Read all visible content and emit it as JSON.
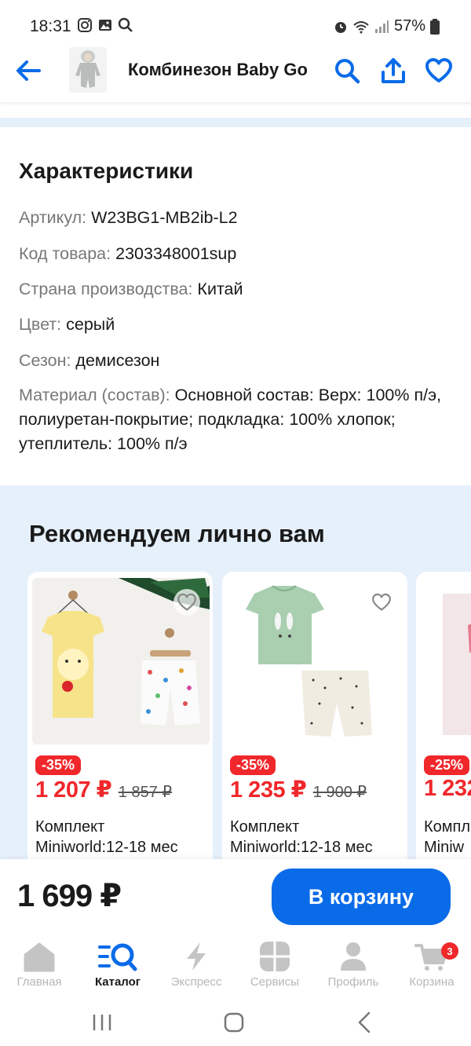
{
  "status_bar": {
    "time": "18:31",
    "battery": "57%",
    "left_icons": [
      "instagram-icon",
      "gallery-icon",
      "search-icon"
    ],
    "right_icons": [
      "alarm-icon",
      "wifi-icon",
      "signal-icon",
      "battery-icon"
    ]
  },
  "header": {
    "title": "Комбинезон Baby Go",
    "icons": [
      "back-arrow-icon",
      "search-icon",
      "share-icon",
      "heart-icon"
    ],
    "accent": "#0a6be8"
  },
  "characteristics": {
    "title": "Характеристики",
    "rows": [
      {
        "key": "Артикул:",
        "value": "W23BG1-MB2ib-L2"
      },
      {
        "key": "Код товара:",
        "value": "2303348001sup"
      },
      {
        "key": "Страна производства:",
        "value": "Китай"
      },
      {
        "key": "Цвет:",
        "value": "серый"
      },
      {
        "key": "Сезон:",
        "value": "демисезон"
      },
      {
        "key": "Материал (состав):",
        "value": "Основной состав: Верх: 100% п/э, полиуретан-покрытие; подкладка: 100% хлопок; утеплитель: 100% п/э"
      }
    ]
  },
  "recommendations": {
    "title": "Рекомендуем лично вам",
    "items": [
      {
        "discount": "-35%",
        "price": "1 207 ₽",
        "old_price": "1 857 ₽",
        "title": "Комплект",
        "subtitle": "Miniworld:12-18 мес"
      },
      {
        "discount": "-35%",
        "price": "1 235 ₽",
        "old_price": "1 900 ₽",
        "title": "Комплект",
        "subtitle": "Miniworld:12-18 мес"
      },
      {
        "discount": "-25%",
        "price": "1 232",
        "old_price": "",
        "title": "Компл",
        "subtitle": "Miniw"
      }
    ]
  },
  "buy_bar": {
    "total": "1 699 ₽",
    "button": "В корзину"
  },
  "bottom_nav": {
    "items": [
      {
        "label": "Главная",
        "icon": "home-icon",
        "active": false
      },
      {
        "label": "Каталог",
        "icon": "catalog-search-icon",
        "active": true
      },
      {
        "label": "Экспресс",
        "icon": "lightning-icon",
        "active": false
      },
      {
        "label": "Сервисы",
        "icon": "services-icon",
        "active": false
      },
      {
        "label": "Профиль",
        "icon": "profile-icon",
        "active": false
      },
      {
        "label": "Корзина",
        "icon": "cart-icon",
        "active": false
      }
    ],
    "cart_count": "3"
  },
  "colors": {
    "primary": "#0a6be8",
    "sale_red": "#f0272b",
    "section_bg": "#e6f0fb"
  }
}
